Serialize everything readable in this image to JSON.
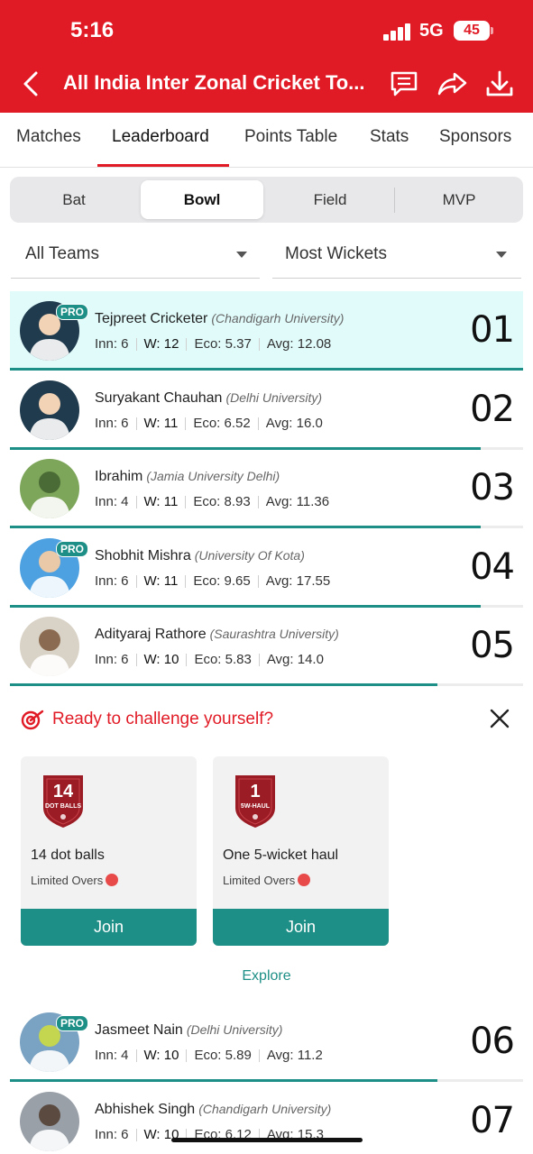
{
  "status_bar": {
    "time": "5:16",
    "network": "5G",
    "battery": "45"
  },
  "nav": {
    "title": "All India Inter Zonal Cricket To...",
    "icons": [
      "back-icon",
      "message-icon",
      "share-icon",
      "download-icon"
    ]
  },
  "tabs": [
    "Matches",
    "Leaderboard",
    "Points Table",
    "Stats",
    "Sponsors"
  ],
  "active_tab": "Leaderboard",
  "segments": [
    "Bat",
    "Bowl",
    "Field",
    "MVP"
  ],
  "active_segment": "Bowl",
  "filters": {
    "team": "All Teams",
    "sort": "Most Wickets"
  },
  "players": [
    {
      "name": "Tejpreet Cricketer",
      "team": "(Chandigarh University)",
      "inn": "Inn: 6",
      "w": "W: 12",
      "eco": "Eco: 5.37",
      "avg": "Avg: 12.08",
      "rank": "01",
      "pro": true,
      "badge": "PRO",
      "highlight": true,
      "progress": 1.0
    },
    {
      "name": "Suryakant Chauhan",
      "team": "(Delhi University)",
      "inn": "Inn: 6",
      "w": "W: 11",
      "eco": "Eco: 6.52",
      "avg": "Avg: 16.0",
      "rank": "02",
      "pro": false,
      "badge": "",
      "highlight": false,
      "progress": 0.917
    },
    {
      "name": "Ibrahim",
      "team": "(Jamia University Delhi)",
      "inn": "Inn: 4",
      "w": "W: 11",
      "eco": "Eco: 8.93",
      "avg": "Avg: 11.36",
      "rank": "03",
      "pro": false,
      "badge": "",
      "highlight": false,
      "progress": 0.917
    },
    {
      "name": "Shobhit Mishra",
      "team": "(University Of Kota)",
      "inn": "Inn: 6",
      "w": "W: 11",
      "eco": "Eco: 9.65",
      "avg": "Avg: 17.55",
      "rank": "04",
      "pro": true,
      "badge": "PRO",
      "highlight": false,
      "progress": 0.917
    },
    {
      "name": "Adityaraj Rathore",
      "team": "(Saurashtra University)",
      "inn": "Inn: 6",
      "w": "W: 10",
      "eco": "Eco: 5.83",
      "avg": "Avg: 14.0",
      "rank": "05",
      "pro": false,
      "badge": "",
      "highlight": false,
      "progress": 0.833
    },
    {
      "name": "Jasmeet Nain",
      "team": "(Delhi University)",
      "inn": "Inn: 4",
      "w": "W: 10",
      "eco": "Eco: 5.89",
      "avg": "Avg: 11.2",
      "rank": "06",
      "pro": true,
      "badge": "PRO",
      "highlight": false,
      "progress": 0.833
    },
    {
      "name": "Abhishek Singh",
      "team": "(Chandigarh University)",
      "inn": "Inn: 6",
      "w": "W: 10",
      "eco": "Eco: 6.12",
      "avg": "Avg: 15.3",
      "rank": "07",
      "pro": false,
      "badge": "",
      "highlight": false,
      "progress": 0.833
    }
  ],
  "challenge": {
    "title": "Ready to challenge yourself?",
    "cards": [
      {
        "badge_number": "14",
        "badge_label": "DOT BALLS",
        "title": "14 dot balls",
        "subtitle": "Limited Overs",
        "button": "Join"
      },
      {
        "badge_number": "1",
        "badge_label": "5W-HAUL",
        "title": "One 5-wicket haul",
        "subtitle": "Limited Overs",
        "button": "Join"
      }
    ],
    "explore": "Explore"
  },
  "colors": {
    "brand_red": "#e11b26",
    "accent_teal": "#1e8f86",
    "highlight_row": "#e1fbfb",
    "badge_maroon": "#9b1c24"
  }
}
